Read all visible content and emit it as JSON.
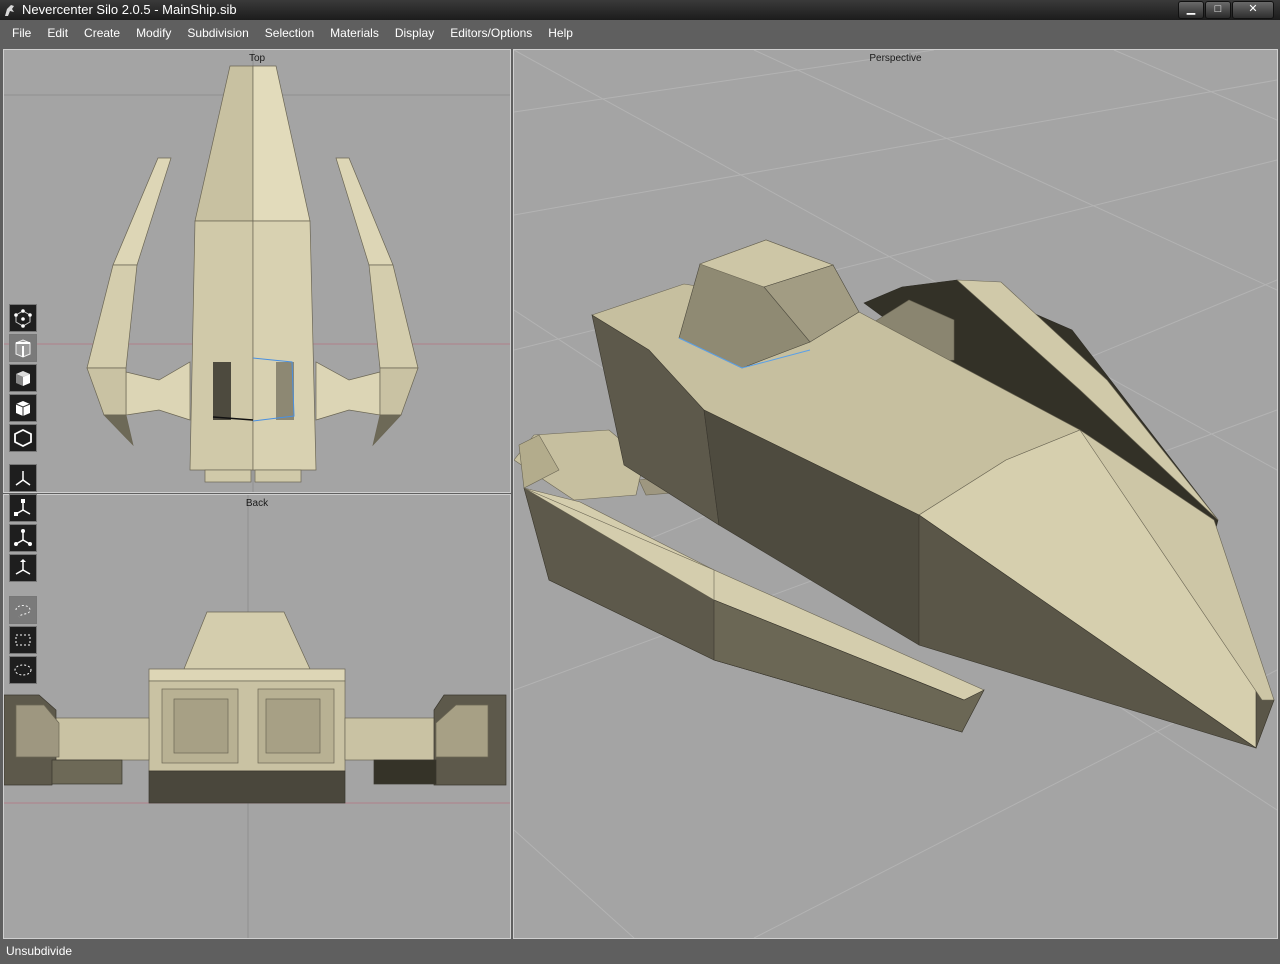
{
  "window": {
    "title": "Nevercenter Silo 2.0.5 - MainShip.sib",
    "min_glyph": "▁",
    "max_glyph": "□",
    "close_glyph": "✕"
  },
  "menu": [
    "File",
    "Edit",
    "Create",
    "Modify",
    "Subdivision",
    "Selection",
    "Materials",
    "Display",
    "Editors/Options",
    "Help"
  ],
  "viewports": {
    "top": "Top",
    "back": "Back",
    "perspective": "Perspective"
  },
  "toolbar": {
    "tools": [
      {
        "icon": "vertex-select-icon"
      },
      {
        "icon": "edge-select-icon",
        "active": true
      },
      {
        "icon": "face-select-icon"
      },
      {
        "icon": "object-select-icon"
      },
      {
        "icon": "wireframe-object-icon"
      },
      {
        "icon": "move-manipulator-icon"
      },
      {
        "icon": "rotate-manipulator-icon"
      },
      {
        "icon": "scale-manipulator-icon"
      },
      {
        "icon": "universal-manipulator-icon"
      },
      {
        "icon": "lasso-select-icon"
      },
      {
        "icon": "rect-select-icon"
      },
      {
        "icon": "ellipse-select-icon"
      }
    ]
  },
  "status": {
    "text": "Unsubdivide"
  },
  "colors": {
    "viewport_bg": "#a4a4a4",
    "model_light": "#d6cfae",
    "model_mid": "#b3ac8c",
    "model_dark": "#5d594b",
    "ui_gray": "#5f5f5f"
  }
}
